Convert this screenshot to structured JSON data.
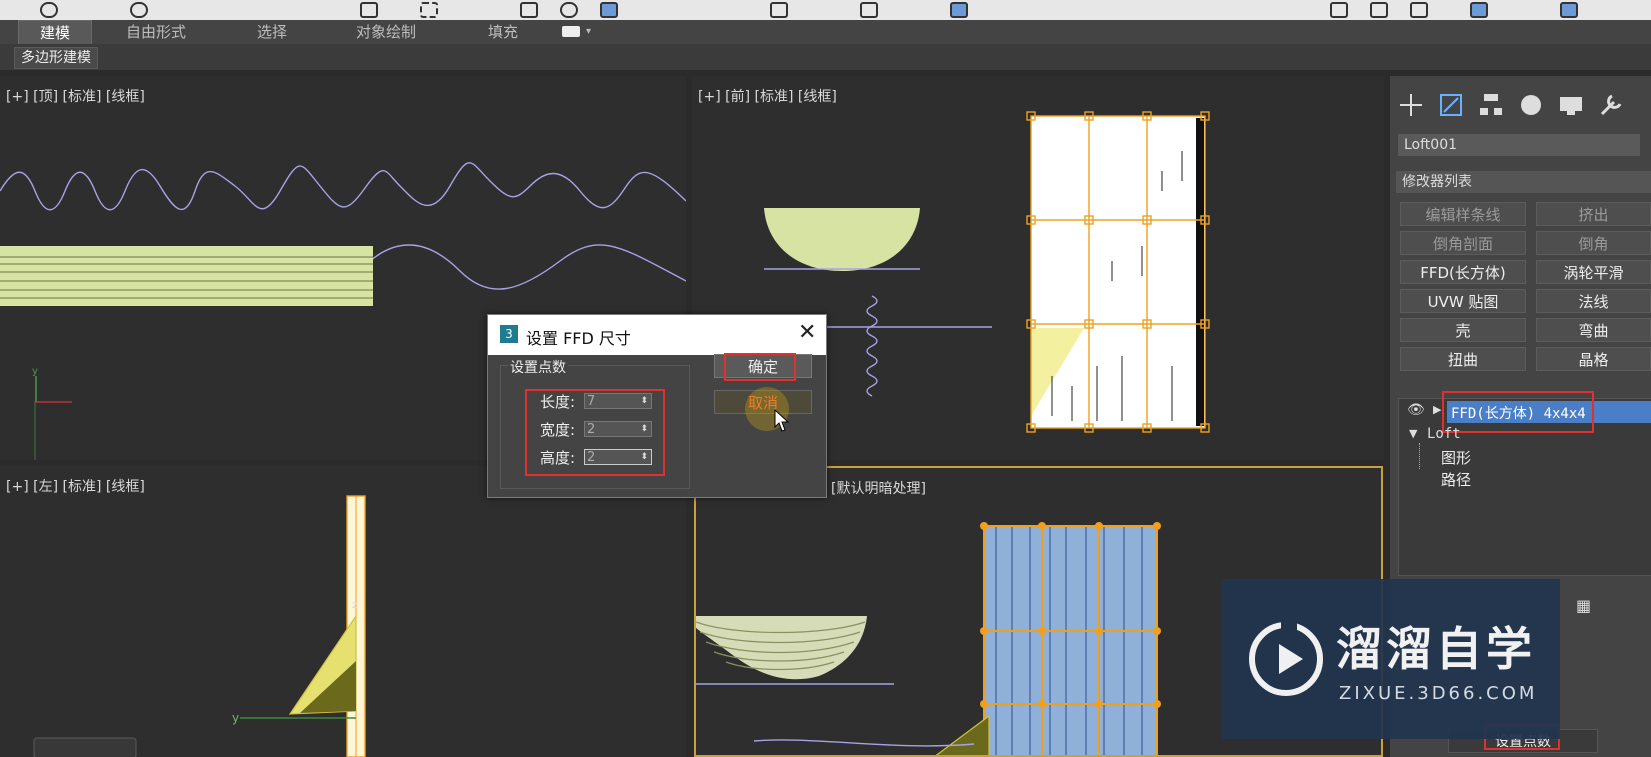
{
  "ribbon": {
    "tabs": [
      "建模",
      "自由形式",
      "选择",
      "对象绘制",
      "填充"
    ],
    "active_tab": "建模",
    "subtab": "多边形建模"
  },
  "viewports": {
    "top_label": "[+] [顶] [标准] [线框]",
    "front_label": "[+] [前] [标准] [线框]",
    "left_label": "[+] [左] [标准] [线框]",
    "persp_label": "[默认明暗处理]"
  },
  "command_panel": {
    "object_name": "Loft001",
    "modifier_list": "修改器列表",
    "modifier_buttons": [
      "编辑样条线",
      "挤出",
      "倒角剖面",
      "倒角",
      "FFD(长方体)",
      "涡轮平滑",
      "UVW 贴图",
      "法线",
      "壳",
      "弯曲",
      "扭曲",
      "晶格"
    ],
    "stack": {
      "ffd_item": "FFD(长方体) 4x4x4",
      "loft_item": "Loft",
      "child_shape": "图形",
      "child_path": "路径"
    },
    "set_points_button": "设置点数"
  },
  "dialog": {
    "title": "设置 FFD 尺寸",
    "group_label": "设置点数",
    "length_label": "长度:",
    "length_value": "7",
    "width_label": "宽度:",
    "width_value": "2",
    "height_label": "高度:",
    "height_value": "2",
    "ok_label": "确定",
    "cancel_label": "取消"
  },
  "watermark": {
    "name": "溜溜自学",
    "url": "ZIXUE.3D66.COM"
  },
  "colors": {
    "highlight_red": "#e03030",
    "lattice_orange": "#f0a020",
    "selection_blue": "#4a7fc8",
    "wire_purple": "#a6a2e8",
    "mesh_yellow": "#d6e3a2"
  }
}
